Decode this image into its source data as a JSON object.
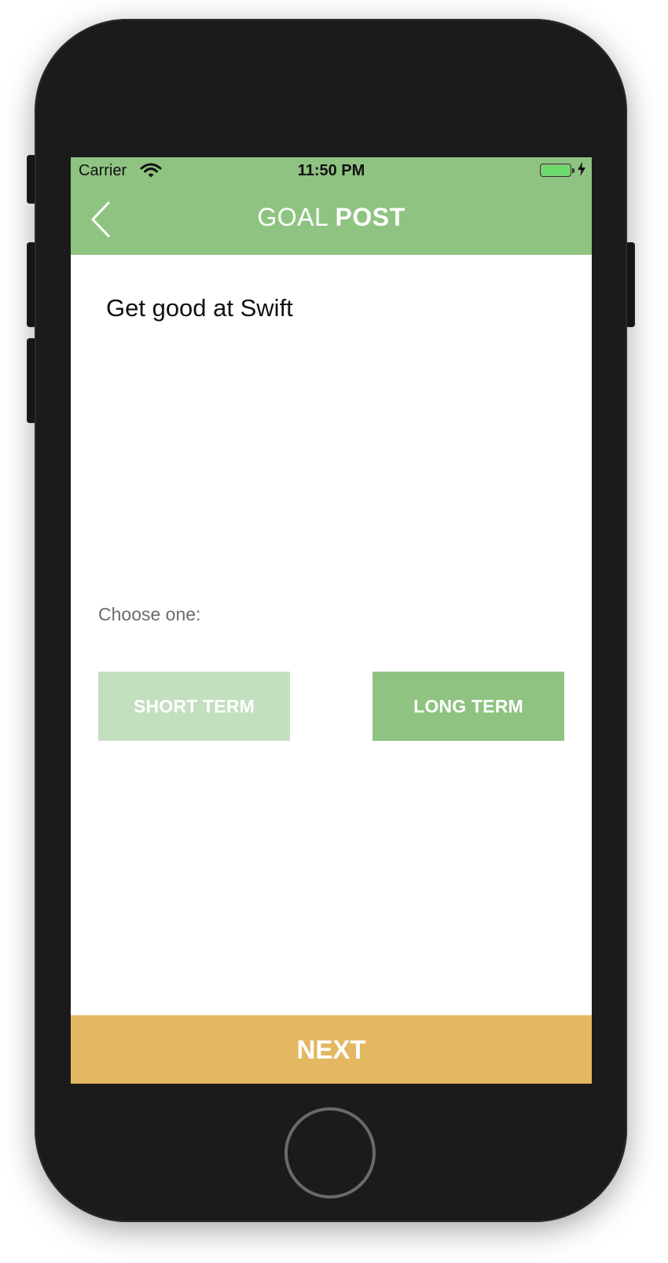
{
  "status_bar": {
    "carrier": "Carrier",
    "time": "11:50 PM"
  },
  "navbar": {
    "title_light": "GOAL",
    "title_bold": "POST",
    "color": "#8fc381"
  },
  "goal": {
    "text": "Get good at Swift"
  },
  "choice": {
    "label": "Choose one:",
    "short_term_label": "SHORT TERM",
    "long_term_label": "LONG TERM",
    "selected": "LONG TERM",
    "selected_color": "#8fc381",
    "unselected_color": "#c3dfbf"
  },
  "footer": {
    "next_label": "NEXT",
    "color": "#e4b863"
  }
}
